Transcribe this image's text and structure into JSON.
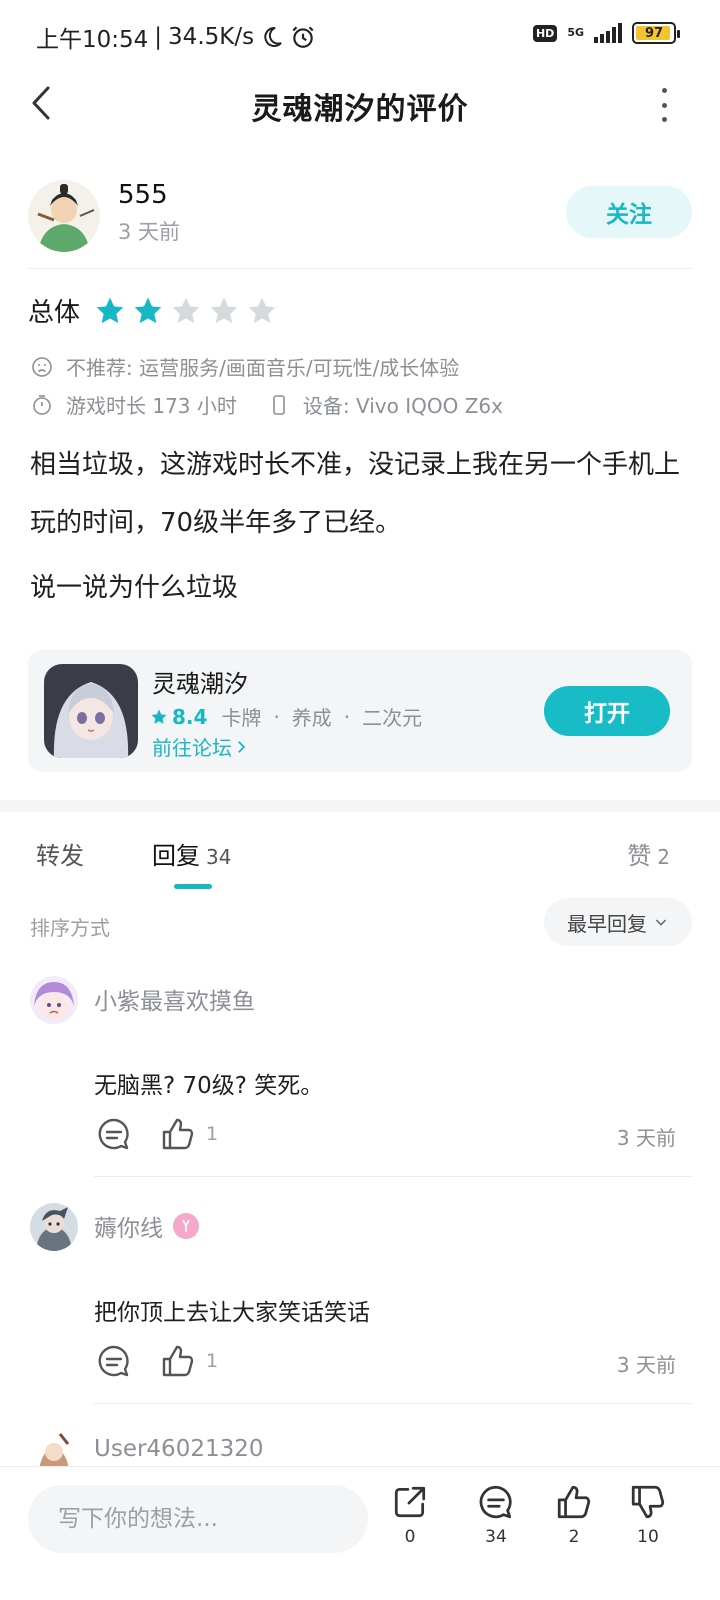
{
  "status_bar": {
    "time": "上午10:54",
    "separator": "|",
    "speed": "34.5K/s",
    "hd": "HD",
    "network": "5G",
    "battery": "97"
  },
  "header": {
    "title": "灵魂潮汐的评价"
  },
  "author": {
    "name": "555",
    "time": "3 天前",
    "follow_label": "关注"
  },
  "rating": {
    "label": "总体",
    "stars": 2,
    "max_stars": 5
  },
  "review": {
    "not_recommend": "不推荐: 运营服务/画面音乐/可玩性/成长体验",
    "play_time": "游戏时长 173 小时",
    "device": "设备: Vivo IQOO Z6x",
    "text": "相当垃圾，这游戏时长不准，没记录上我在另一个手机上玩的时间，70级半年多了已经。",
    "text2": "说一说为什么垃圾"
  },
  "game_card": {
    "name": "灵魂潮汐",
    "score": "8.4",
    "tag1": "卡牌",
    "tag2": "养成",
    "tag3": "二次元",
    "dot": "·",
    "forum_link": "前往论坛",
    "open_label": "打开"
  },
  "tabs": {
    "forward": "转发",
    "reply": "回复",
    "reply_count": "34",
    "like": "赞",
    "like_count": "2"
  },
  "sort": {
    "label": "排序方式",
    "value": "最早回复"
  },
  "comments": [
    {
      "name": "小紫最喜欢摸鱼",
      "text": "无脑黑? 70级? 笑死。",
      "likes": "1",
      "time": "3 天前"
    },
    {
      "name": "薅你线",
      "text": "把你顶上去让大家笑话笑话",
      "likes": "1",
      "time": "3 天前"
    },
    {
      "name": "User46021320"
    }
  ],
  "bottom_bar": {
    "placeholder": "写下你的想法...",
    "share_count": "0",
    "reply_count": "34",
    "like_count": "2",
    "dislike_count": "10"
  },
  "colors": {
    "accent": "#17b8c4",
    "star_empty": "#d6dadd",
    "battery": "#f4c430"
  }
}
